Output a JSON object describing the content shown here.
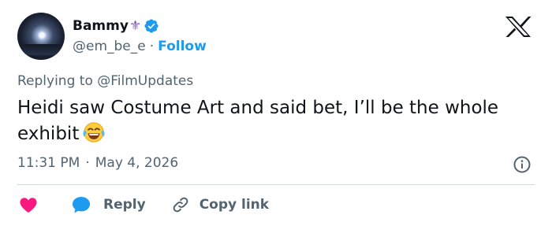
{
  "author": {
    "display_name": "Bammy",
    "name_emoji": "⚜",
    "handle": "@em_be_e",
    "separator": "·",
    "follow_label": "Follow",
    "verified": true,
    "avatar_icon": "avatar-night-city"
  },
  "brand": {
    "logo_icon": "x-logo-icon"
  },
  "reply_context": {
    "prefix": "Replying to",
    "mention": "@FilmUpdates"
  },
  "tweet": {
    "text": "Heidi saw Costume Art and said bet, I’ll be the whole exhibit",
    "emoji_icon": "face-with-tears-of-joy-icon"
  },
  "meta": {
    "time": "11:31 PM",
    "separator": "·",
    "date": "May 4, 2026",
    "info_icon": "info-icon"
  },
  "actions": {
    "like_icon": "heart-icon",
    "reply_label": "Reply",
    "reply_icon": "speech-bubble-icon",
    "copy_label": "Copy link",
    "copy_icon": "link-icon"
  },
  "colors": {
    "accent": "#1d9bf0",
    "heart": "#f91880",
    "text_primary": "#0f1419",
    "text_secondary": "#536471",
    "divider": "#cfd9de"
  }
}
